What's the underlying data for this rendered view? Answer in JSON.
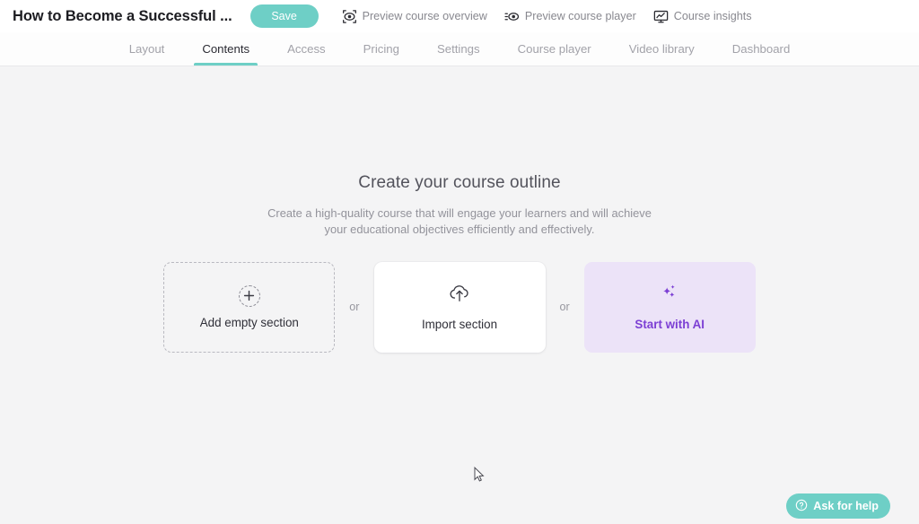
{
  "topbar": {
    "course_title": "How to Become a Successful ...",
    "save_label": "Save",
    "actions": [
      {
        "label": "Preview course overview",
        "icon": "eye-focus-icon"
      },
      {
        "label": "Preview course player",
        "icon": "eye-play-icon"
      },
      {
        "label": "Course insights",
        "icon": "monitor-chart-icon"
      }
    ]
  },
  "tabs": [
    {
      "label": "Layout",
      "active": false
    },
    {
      "label": "Contents",
      "active": true
    },
    {
      "label": "Access",
      "active": false
    },
    {
      "label": "Pricing",
      "active": false
    },
    {
      "label": "Settings",
      "active": false
    },
    {
      "label": "Course player",
      "active": false
    },
    {
      "label": "Video library",
      "active": false
    },
    {
      "label": "Dashboard",
      "active": false
    }
  ],
  "main": {
    "headline": "Create your course outline",
    "subhead": "Create a high-quality course that will engage your learners and will achieve your educational objectives efficiently and effectively.",
    "separator": "or",
    "cards": [
      {
        "label": "Add empty section",
        "icon": "plus-icon",
        "style": "dashed"
      },
      {
        "label": "Import section",
        "icon": "cloud-upload-icon",
        "style": "white"
      },
      {
        "label": "Start with AI",
        "icon": "sparkles-icon",
        "style": "ai"
      }
    ]
  },
  "help": {
    "label": "Ask for help",
    "icon": "question-circle-icon"
  },
  "colors": {
    "accent_teal": "#6ecfc6",
    "ai_purple": "#7c3fd4",
    "ai_background": "#ece3f8",
    "page_background": "#f4f4f5",
    "text_primary": "#2f2f38",
    "text_muted": "#93939b"
  }
}
